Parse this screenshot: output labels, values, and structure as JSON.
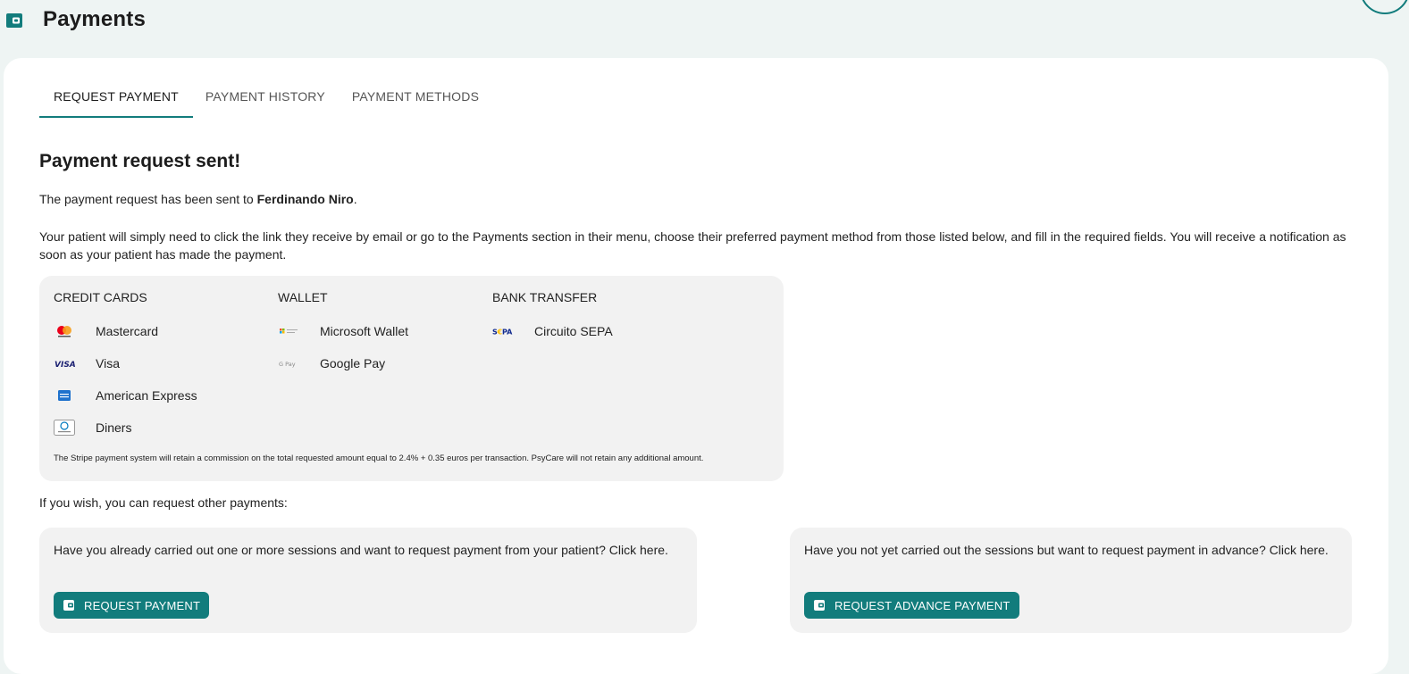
{
  "header": {
    "title": "Payments",
    "icon": "wallet-icon",
    "accent_color": "#127c7c"
  },
  "tabs": [
    {
      "label": "REQUEST PAYMENT",
      "active": true
    },
    {
      "label": "PAYMENT HISTORY",
      "active": false
    },
    {
      "label": "PAYMENT METHODS",
      "active": false
    }
  ],
  "confirmation": {
    "heading": "Payment request sent!",
    "sent_prefix": "The payment request has been sent to ",
    "patient_name": "Ferdinando Niro",
    "sent_suffix": ".",
    "instructions": "Your patient will simply need to click the link they receive by email or go to the Payments section in their menu, choose their preferred payment method from those listed below, and fill in the required fields. You will receive a notification as soon as your patient has made the payment."
  },
  "payment_methods": {
    "credit_cards": {
      "title": "CREDIT CARDS",
      "items": [
        {
          "label": "Mastercard",
          "icon": "mastercard-icon"
        },
        {
          "label": "Visa",
          "icon": "visa-icon"
        },
        {
          "label": "American Express",
          "icon": "amex-icon"
        },
        {
          "label": "Diners",
          "icon": "diners-icon"
        }
      ]
    },
    "wallet": {
      "title": "WALLET",
      "items": [
        {
          "label": "Microsoft Wallet",
          "icon": "microsoft-wallet-icon"
        },
        {
          "label": "Google Pay",
          "icon": "google-pay-icon"
        }
      ]
    },
    "bank_transfer": {
      "title": "BANK TRANSFER",
      "items": [
        {
          "label": "Circuito SEPA",
          "icon": "sepa-icon"
        }
      ]
    },
    "fine_print": "The Stripe payment system will retain a commission on the total requested amount equal to 2.4% + 0.35 euros per transaction. PsyCare will not retain any additional amount."
  },
  "other_payments": {
    "label": "If you wish, you can request other payments:",
    "completed_sessions": {
      "text": "Have you already carried out one or more sessions and want to request payment from your patient? Click here.",
      "button": "REQUEST PAYMENT"
    },
    "advance": {
      "text": "Have you not yet carried out the sessions but want to request payment in advance? Click here.",
      "button": "REQUEST ADVANCE PAYMENT"
    }
  }
}
